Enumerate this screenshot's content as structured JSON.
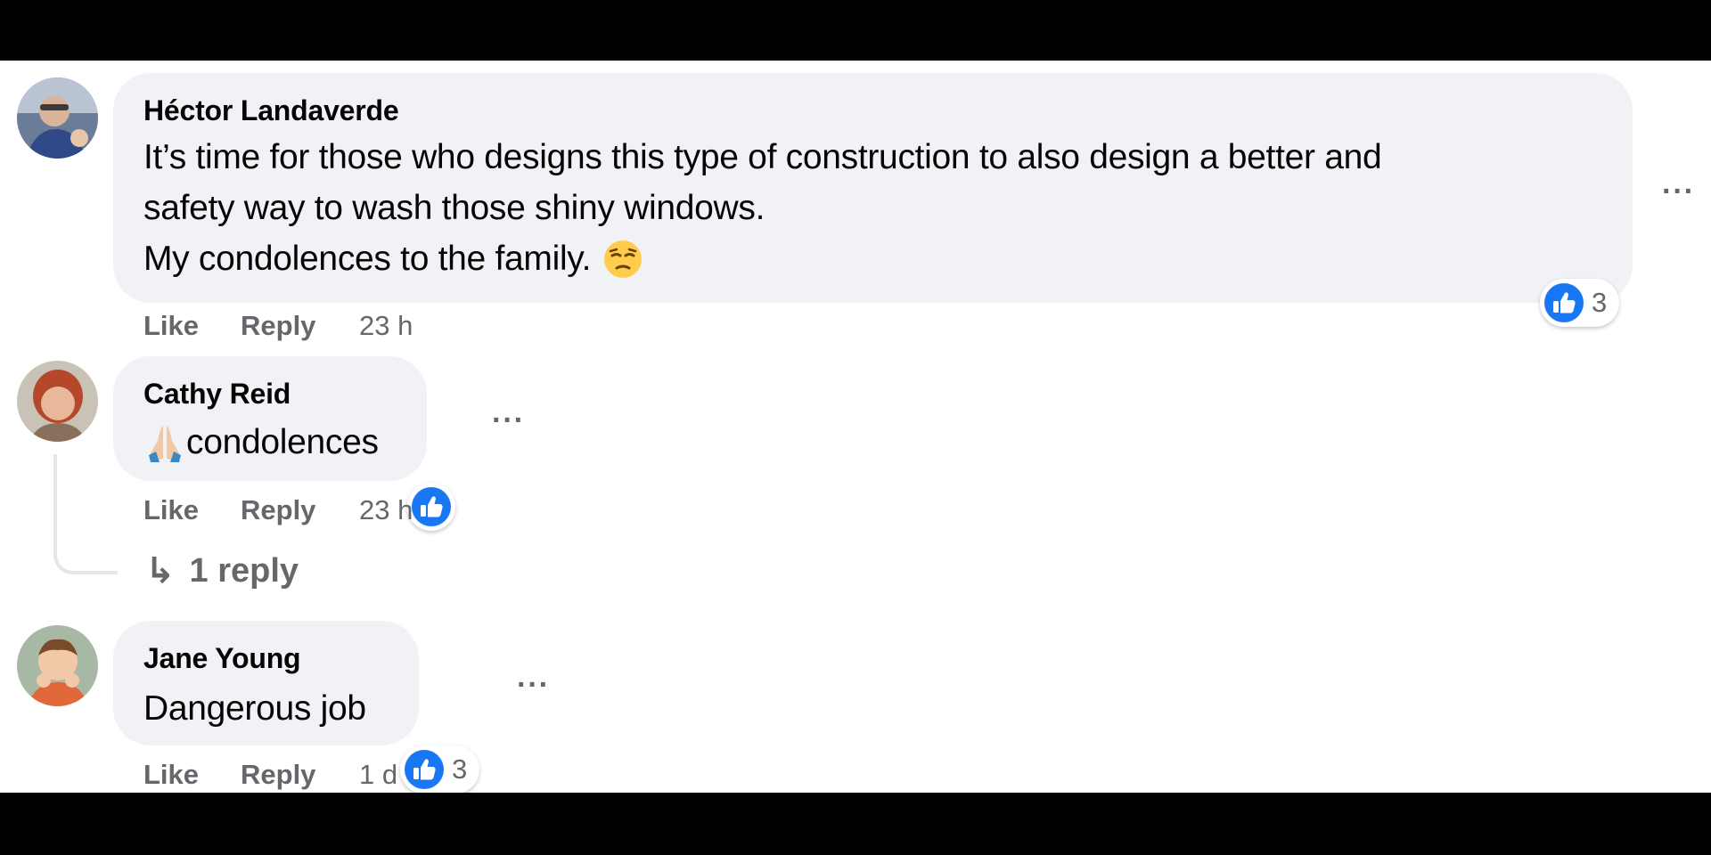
{
  "colors": {
    "bubble_bg": "#f0f2f5",
    "like_blue": "#1877f2",
    "meta_gray": "#65676b",
    "text": "#050505"
  },
  "comments": [
    {
      "author": "Héctor Landaverde",
      "lines": [
        "It’s time for those who designs this type of construction to also design a better and",
        "safety way to wash those shiny windows.",
        "My condolences to the family."
      ],
      "trailing_emoji": "pensive-face-emoji",
      "like_label": "Like",
      "reply_label": "Reply",
      "time": "23 h",
      "reaction_count": "3",
      "more_label": "···"
    },
    {
      "author": "Cathy Reid",
      "leading_emoji": "folded-hands-emoji",
      "text": "condolences",
      "like_label": "Like",
      "reply_label": "Reply",
      "time": "23 h",
      "more_label": "···",
      "replies_label": "1 reply",
      "replies_icon": "↳"
    },
    {
      "author": "Jane Young",
      "text": "Dangerous job",
      "like_label": "Like",
      "reply_label": "Reply",
      "time": "1 d",
      "reaction_count": "3",
      "more_label": "···"
    }
  ]
}
